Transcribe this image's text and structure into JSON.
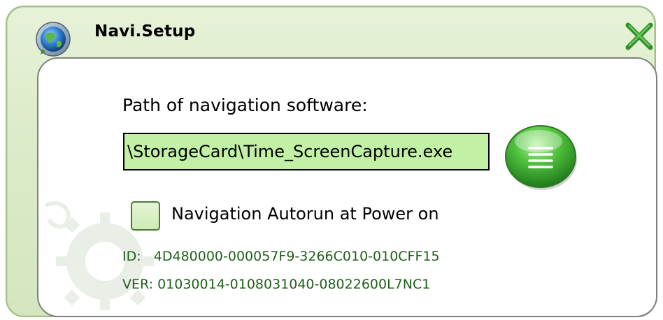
{
  "window": {
    "title": "Navi.Setup",
    "title_icon": "globe-icon",
    "close_icon": "close-x-icon"
  },
  "panel": {
    "path_label": "Path of navigation software:",
    "path_value": "\\StorageCard\\Time_ScreenCapture.exe",
    "browse_icon": "list-icon",
    "autorun": {
      "label": "Navigation Autorun at Power on",
      "checked": false
    },
    "id_label": "ID:",
    "id_value": "4D480000-000057F9-3266C010-010CFF15",
    "ver_label": "VER:",
    "ver_value": "01030014-0108031040-08022600L7NC1"
  },
  "colors": {
    "window_bg": "#dcebc9",
    "field_bg": "#c2f0a4",
    "accent_green": "#3fa33a",
    "info_text": "#1f5f1a"
  }
}
